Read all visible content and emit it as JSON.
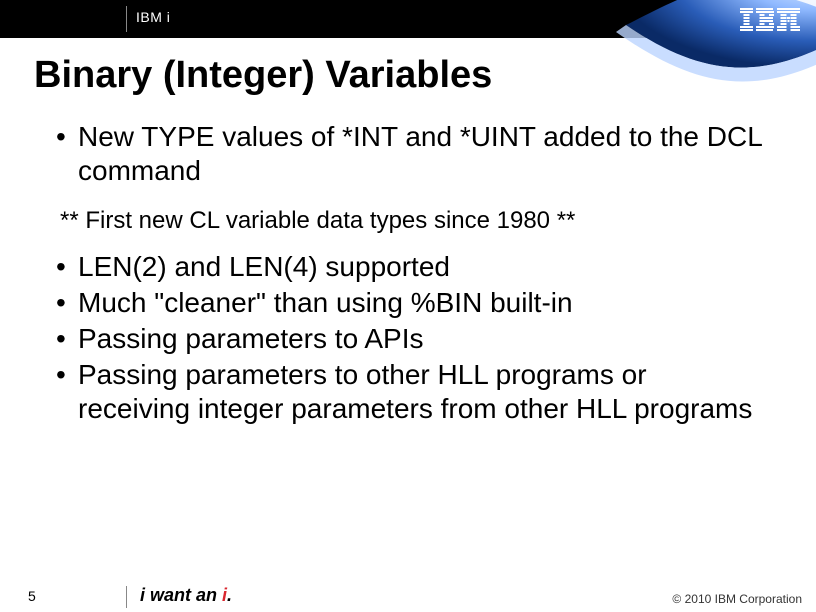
{
  "header": {
    "product_label": "IBM i",
    "logo_name": "IBM"
  },
  "title": "Binary (Integer) Variables",
  "bullets_top": [
    "New TYPE values of *INT and *UINT added to the DCL command"
  ],
  "note": "** First new CL variable data types since 1980 **",
  "bullets_bottom": [
    "LEN(2) and LEN(4) supported",
    "Much \"cleaner\" than using %BIN built-in",
    "Passing parameters to  APIs",
    "Passing parameters to other HLL programs or receiving integer parameters from other HLL programs"
  ],
  "footer": {
    "page_number": "5",
    "tagline_prefix": "i want an ",
    "tagline_accent": "i",
    "tagline_suffix": ".",
    "copyright": "© 2010 IBM Corporation"
  }
}
